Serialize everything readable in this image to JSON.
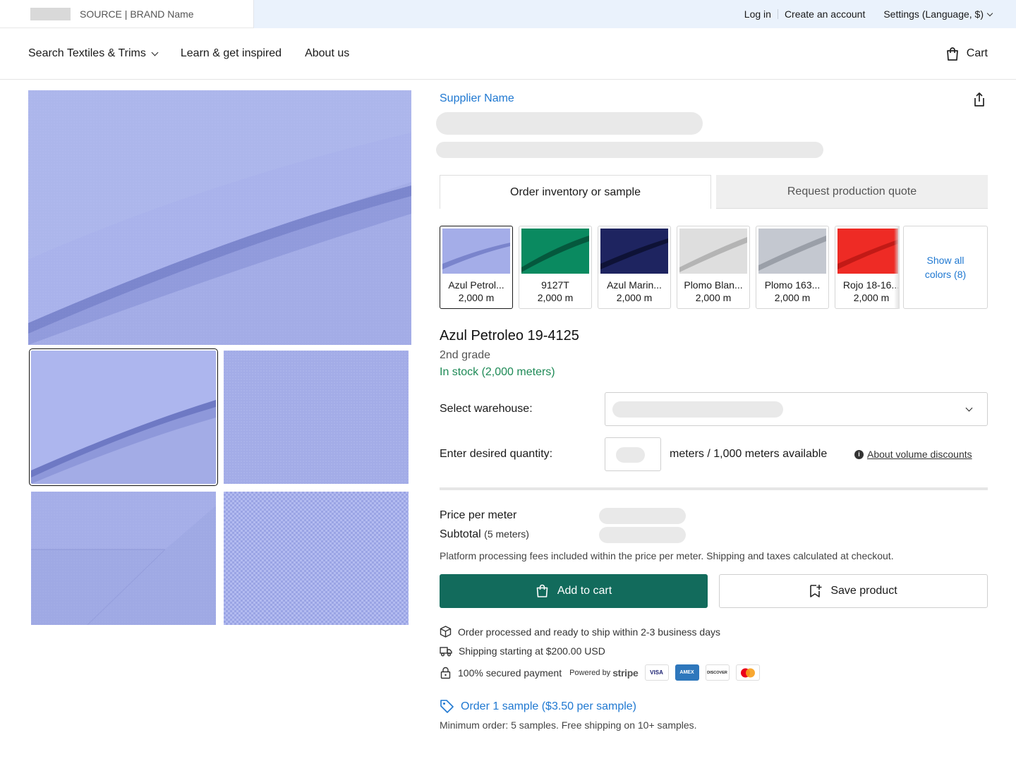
{
  "topbar": {
    "brand": "SOURCE | BRAND Name",
    "login": "Log in",
    "create_account": "Create an account",
    "settings": "Settings (Language, $)"
  },
  "nav": {
    "search": "Search Textiles & Trims",
    "learn": "Learn & get inspired",
    "about": "About us",
    "cart": "Cart"
  },
  "product": {
    "supplier": "Supplier Name",
    "tabs": {
      "active": "Order inventory or sample",
      "inactive": "Request production quote"
    },
    "swatches": [
      {
        "name": "Azul Petrol...",
        "qty": "2,000 m",
        "color": "#9ea8e0"
      },
      {
        "name": "9127T",
        "qty": "2,000 m",
        "color": "#0a8a60"
      },
      {
        "name": "Azul Marin...",
        "qty": "2,000 m",
        "color": "#1e2460"
      },
      {
        "name": "Plomo Blan...",
        "qty": "2,000 m",
        "color": "#dcdcdc"
      },
      {
        "name": "Plomo 163...",
        "qty": "2,000 m",
        "color": "#c0c4cc"
      },
      {
        "name": "Rojo 18-16...",
        "qty": "2,000 m",
        "color": "#ee2b25"
      }
    ],
    "show_all": "Show all colors (8)",
    "title": "Azul Petroleo 19-4125",
    "grade": "2nd grade",
    "stock": "In stock (2,000 meters)",
    "warehouse_label": "Select warehouse:",
    "quantity_label": "Enter desired quantity:",
    "meters_text": "meters / 1,000 meters available",
    "volume_link": "About volume discounts",
    "price_label": "Price per meter",
    "subtotal_label": "Subtotal",
    "subtotal_note": "(5 meters)",
    "fees": "Platform processing fees included within the price per meter. Shipping and taxes calculated at checkout.",
    "add_to_cart": "Add to cart",
    "save_product": "Save product",
    "ship_info": "Order processed and ready to ship within 2-3 business days",
    "shipping": "Shipping starting at $200.00 USD",
    "secure": "100% secured payment",
    "powered_by": "Powered by",
    "stripe": "stripe",
    "cards": [
      "VISA",
      "AMEX",
      "DISCOVER"
    ],
    "sample_link": "Order 1 sample ($3.50 per sample)",
    "min_order": "Minimum order: 5 samples. Free shipping on 10+ samples."
  },
  "colors": {
    "accent": "#126b5c",
    "link": "#1f78d1",
    "stock": "#1e8a56",
    "topbar_bg": "#eaf2fc"
  }
}
